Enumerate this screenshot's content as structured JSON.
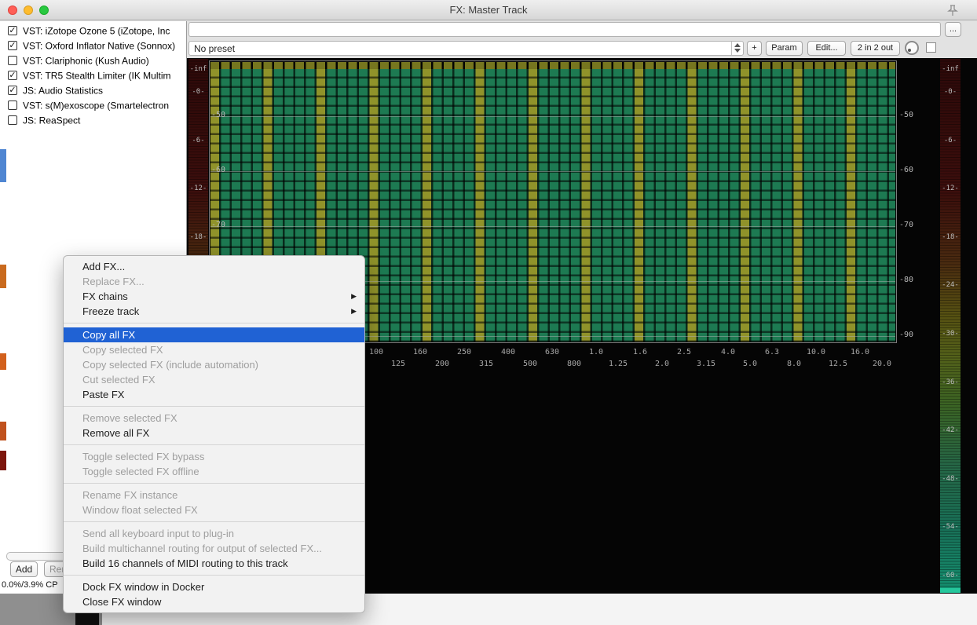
{
  "window": {
    "title": "FX: Master Track"
  },
  "fx_list": {
    "items": [
      {
        "label": "VST: iZotope Ozone 5 (iZotope, Inc",
        "checked": true
      },
      {
        "label": "VST: Oxford Inflator Native (Sonnox)",
        "checked": true
      },
      {
        "label": "VST: Clariphonic (Kush Audio)",
        "checked": false
      },
      {
        "label": "VST: TR5 Stealth Limiter (IK Multim",
        "checked": true
      },
      {
        "label": "JS: Audio Statistics",
        "checked": true
      },
      {
        "label": "VST: s(M)exoscope (Smartelectron",
        "checked": false
      },
      {
        "label": "JS: ReaSpect",
        "checked": false
      }
    ],
    "add_button": "Add",
    "remove_button": "Rem",
    "cpu_text": "0.0%/3.9% CP"
  },
  "toolbar": {
    "comment_value": "",
    "more_button": "...",
    "preset_value": "No preset",
    "plus_button": "+",
    "param_button": "Param",
    "edit_button": "Edit...",
    "io_button": "2 in 2 out"
  },
  "plugin": {
    "meter_scale": [
      "-inf",
      "-0-",
      "-6-",
      "-12-",
      "-18-",
      "-24-",
      "-30-",
      "-36-",
      "-42-",
      "-48-",
      "-54-",
      "-60-"
    ],
    "db_labels": [
      "-50",
      "-60",
      "-70",
      "-80",
      "-90"
    ],
    "freq_labels": [
      "100",
      "125",
      "160",
      "200",
      "250",
      "315",
      "400",
      "500",
      "630",
      "800",
      "1.0",
      "1.25",
      "1.6",
      "2.0",
      "2.5",
      "3.15",
      "4.0",
      "5.0",
      "6.3",
      "8.0",
      "10.0",
      "12.5",
      "16.0",
      "20.0"
    ]
  },
  "context_menu": {
    "sections": [
      {
        "items": [
          {
            "label": "Add FX...",
            "enabled": true
          },
          {
            "label": "Replace FX...",
            "enabled": false
          },
          {
            "label": "FX chains",
            "enabled": true,
            "submenu": true
          },
          {
            "label": "Freeze track",
            "enabled": true,
            "submenu": true
          }
        ]
      },
      {
        "items": [
          {
            "label": "Copy all FX",
            "enabled": true,
            "highlighted": true
          },
          {
            "label": "Copy selected FX",
            "enabled": false
          },
          {
            "label": "Copy selected FX (include automation)",
            "enabled": false
          },
          {
            "label": "Cut selected FX",
            "enabled": false
          },
          {
            "label": "Paste FX",
            "enabled": true
          }
        ]
      },
      {
        "items": [
          {
            "label": "Remove selected FX",
            "enabled": false
          },
          {
            "label": "Remove all FX",
            "enabled": true
          }
        ]
      },
      {
        "items": [
          {
            "label": "Toggle selected FX bypass",
            "enabled": false
          },
          {
            "label": "Toggle selected FX offline",
            "enabled": false
          }
        ]
      },
      {
        "items": [
          {
            "label": "Rename FX instance",
            "enabled": false
          },
          {
            "label": "Window float selected FX",
            "enabled": false
          }
        ]
      },
      {
        "items": [
          {
            "label": "Send all keyboard input to plug-in",
            "enabled": false
          },
          {
            "label": "Build multichannel routing for output of selected FX...",
            "enabled": false
          },
          {
            "label": "Build 16 channels of MIDI routing to this track",
            "enabled": true
          }
        ]
      },
      {
        "items": [
          {
            "label": "Dock FX window in Docker",
            "enabled": true
          },
          {
            "label": "Close FX window",
            "enabled": true
          }
        ]
      }
    ]
  },
  "colors": {
    "menu_highlight": "#2062d4",
    "spectrum_green": "#1d7a52",
    "spectrum_olive": "#969428",
    "meter_top": "#2d0909",
    "meter_bottom": "#149070"
  }
}
